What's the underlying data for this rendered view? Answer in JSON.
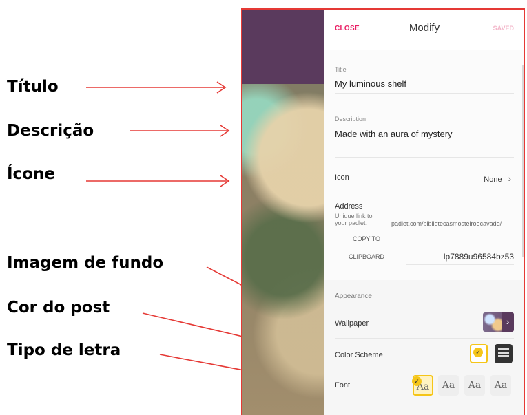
{
  "annotations": {
    "titulo": "Título",
    "descricao": "Descrição",
    "icone": "Ícone",
    "imagem_fundo": "Imagem de fundo",
    "cor_post": "Cor do post",
    "tipo_letra": "Tipo de letra"
  },
  "header": {
    "close": "CLOSE",
    "title": "Modify",
    "saved": "SAVED"
  },
  "form": {
    "title_label": "Title",
    "title_value": "My luminous shelf",
    "description_label": "Description",
    "description_value": "Made with an aura of mystery",
    "icon_label": "Icon",
    "icon_value": "None",
    "address_label": "Address",
    "address_hint_1": "Unique link to",
    "address_hint_2": "your padlet.",
    "address_url": "padlet.com/bibliotecasmosteiroecavado/",
    "address_slug": "lp7889u96584bz53",
    "copy_to": "COPY TO",
    "clipboard": "CLIPBOARD"
  },
  "appearance": {
    "heading": "Appearance",
    "wallpaper": "Wallpaper",
    "color_scheme": "Color Scheme",
    "font": "Font",
    "font_samples": [
      "Aa",
      "Aa",
      "Aa",
      "Aa"
    ]
  },
  "colors": {
    "accent": "#e91e63",
    "annotation_arrow": "#e53935",
    "header_purple": "#5a3a5d",
    "check_yellow": "#f5c518"
  }
}
